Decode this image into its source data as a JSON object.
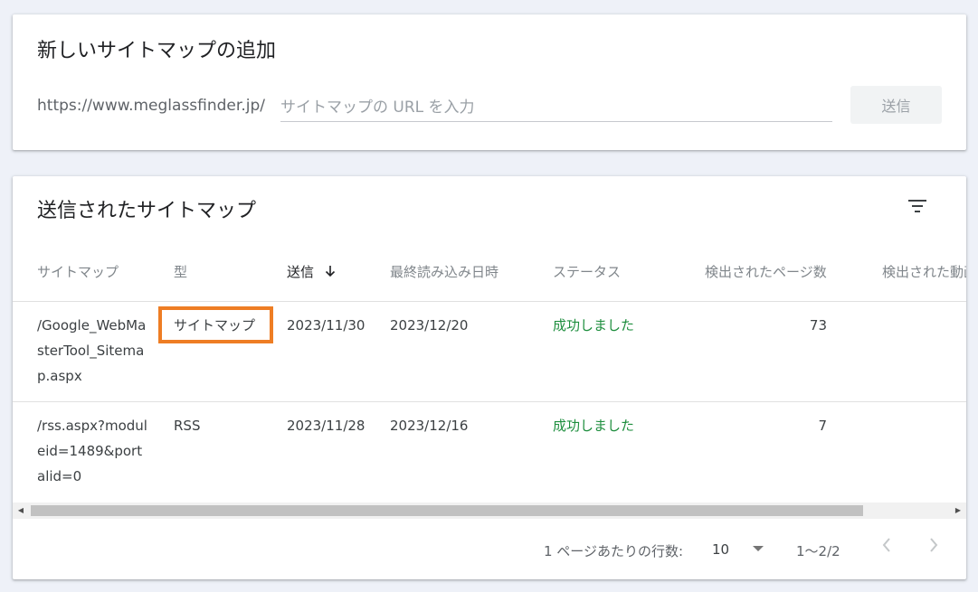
{
  "add_sitemap": {
    "title": "新しいサイトマップの追加",
    "url_prefix": "https://www.meglassfinder.jp/",
    "input_placeholder": "サイトマップの URL を入力",
    "input_value": "",
    "submit_label": "送信"
  },
  "submitted": {
    "title": "送信されたサイトマップ",
    "filter_icon": "filter-icon",
    "columns": {
      "sitemap": "サイトマップ",
      "type": "型",
      "submitted": "送信",
      "last_read": "最終読み込み日時",
      "status": "ステータス",
      "discovered_pages": "検出されたページ数",
      "discovered_videos": "検出された動画"
    },
    "sort_icon": "arrow-down-icon",
    "rows": [
      {
        "sitemap": "/Google_WebMasterTool_Sitemap.aspx",
        "type": "サイトマップ",
        "submitted": "2023/11/30",
        "last_read": "2023/12/20",
        "status": "成功しました",
        "discovered_pages": "73"
      },
      {
        "sitemap": "/rss.aspx?moduleid=1489&portalid=0",
        "type": "RSS",
        "submitted": "2023/11/28",
        "last_read": "2023/12/16",
        "status": "成功しました",
        "discovered_pages": "7"
      }
    ],
    "footer": {
      "rows_per_page_label": "1 ページあたりの行数:",
      "rows_per_page_value": "10",
      "range": "1〜2/2"
    }
  },
  "colors": {
    "success": "#1e8e3e",
    "highlight": "#ee7d24",
    "background": "#eef1f8"
  }
}
